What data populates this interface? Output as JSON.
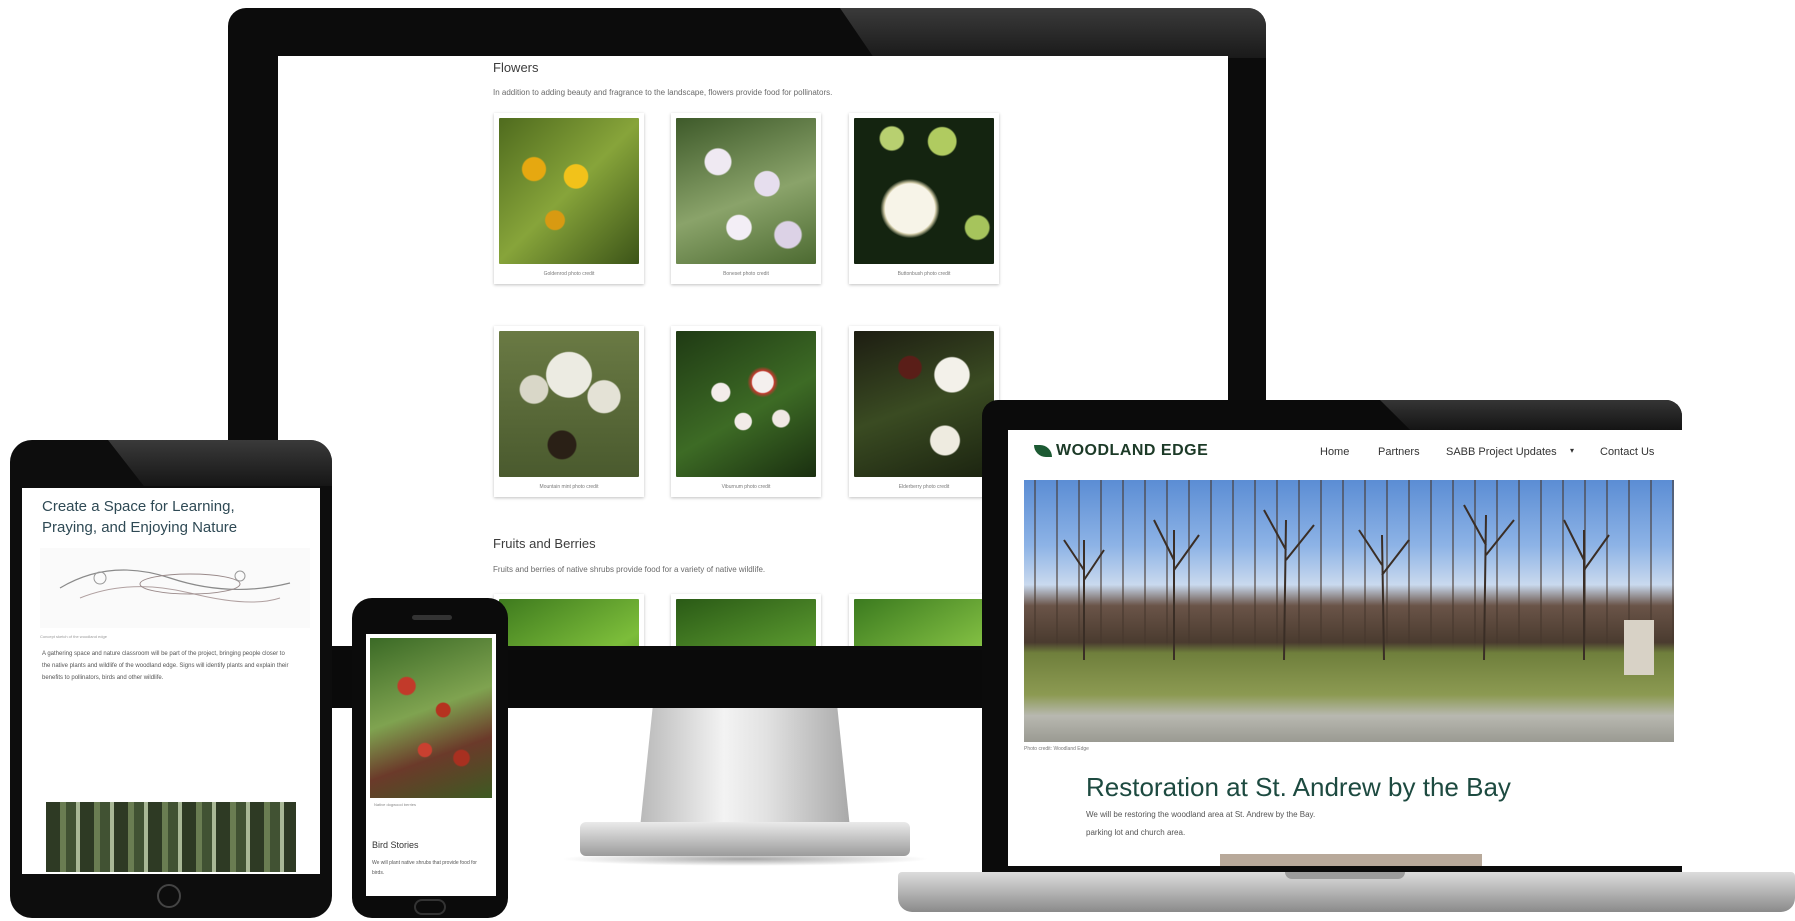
{
  "monitor": {
    "flowers_title": "Flowers",
    "flowers_desc": "In addition to adding beauty and fragrance to the landscape, flowers provide food for pollinators.",
    "flower_cards": [
      {
        "caption": "Goldenrod photo credit"
      },
      {
        "caption": "Boneset photo credit"
      },
      {
        "caption": "Buttonbush photo credit"
      },
      {
        "caption": "Mountain mint photo credit"
      },
      {
        "caption": "Viburnum photo credit"
      },
      {
        "caption": "Elderberry photo credit"
      }
    ],
    "fruits_title": "Fruits and Berries",
    "fruits_desc": "Fruits and berries of native shrubs provide food for a variety of native wildlife."
  },
  "laptop": {
    "logo": "WOODLAND EDGE",
    "nav": [
      "Home",
      "Partners",
      "SABB Project Updates",
      "Contact Us"
    ],
    "hero_caption": "Photo credit: Woodland Edge",
    "hero_title": "Restoration at St. Andrew by the Bay",
    "hero_text_line1": "We will be restoring the woodland area at St. Andrew by the Bay.",
    "hero_text_line2": "parking lot and church area."
  },
  "tablet": {
    "title_line1": "Create a Space for Learning,",
    "title_line2": "Praying, and Enjoying Nature",
    "sketch_caption": "Concept sketch of the woodland edge",
    "body": "A gathering space and nature classroom will be part of the project, bringing people closer to the native plants and wildlife of the woodland edge. Signs will identify plants and explain their benefits to pollinators, birds and other wildlife."
  },
  "phone": {
    "caption": "Native dogwood berries",
    "heading": "Bird Stories",
    "body": "We will plant native shrubs that provide food for birds."
  },
  "colors": {
    "accent": "#1c5a33",
    "heading": "#1d4a40",
    "frame": "#0c0c0c"
  }
}
